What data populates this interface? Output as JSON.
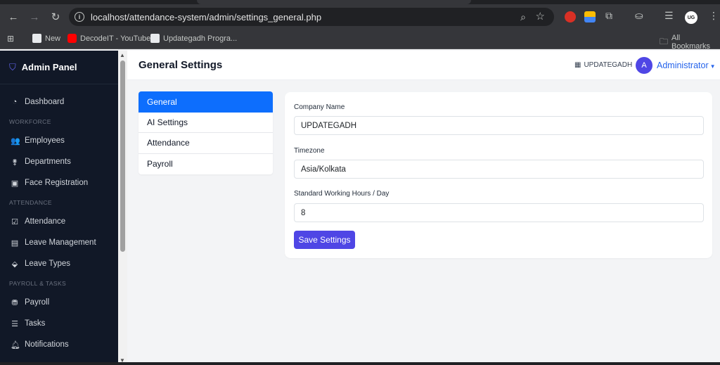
{
  "browser": {
    "url": "localhost/attendance-system/admin/settings_general.php",
    "bookmarks": [
      {
        "label": "New"
      },
      {
        "label": "DecodeIT - YouTube"
      },
      {
        "label": "Updategadh Progra..."
      }
    ],
    "all_bookmarks": "All Bookmarks",
    "profile_initials": "UG"
  },
  "sidebar": {
    "brand": "Admin Panel",
    "dashboard": "Dashboard",
    "sections": {
      "workforce": "WORKFORCE",
      "attendance": "ATTENDANCE",
      "payroll_tasks": "PAYROLL & TASKS"
    },
    "items": {
      "employees": "Employees",
      "departments": "Departments",
      "face_registration": "Face Registration",
      "attendance": "Attendance",
      "leave_management": "Leave Management",
      "leave_types": "Leave Types",
      "payroll": "Payroll",
      "tasks": "Tasks",
      "notifications": "Notifications"
    }
  },
  "header": {
    "title": "General Settings",
    "company": "UPDATEGADH",
    "avatar_initial": "A",
    "user": "Administrator"
  },
  "tabs": [
    "General",
    "AI Settings",
    "Attendance",
    "Payroll"
  ],
  "form": {
    "company_label": "Company Name",
    "company_value": "UPDATEGADH",
    "timezone_label": "Timezone",
    "timezone_value": "Asia/Kolkata",
    "hours_label": "Standard Working Hours / Day",
    "hours_value": "8",
    "save_label": "Save Settings"
  },
  "colors": {
    "sidebar_bg": "#111827",
    "active_tab": "#0d6efd",
    "primary": "#4f46e5",
    "link": "#2563eb"
  }
}
